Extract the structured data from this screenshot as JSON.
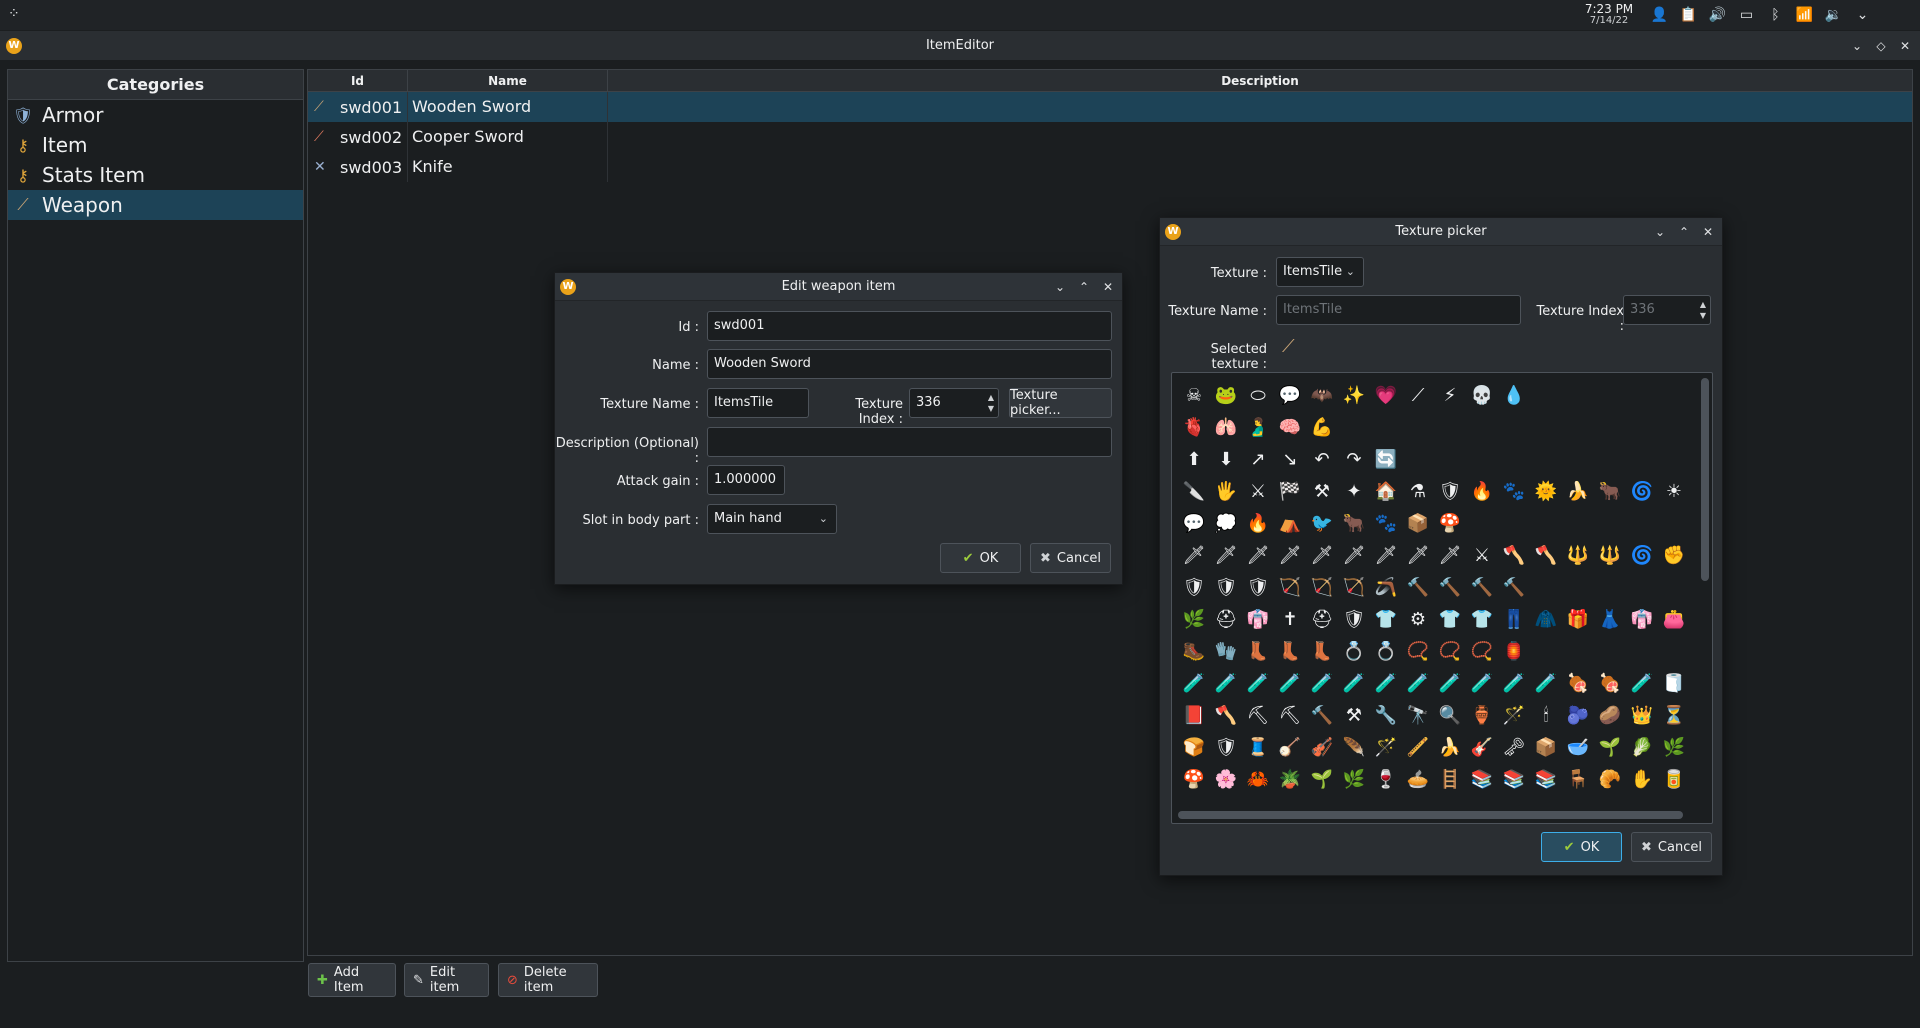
{
  "system_bar": {
    "launcher_icon": "launcher-icon",
    "time": "7:23 PM",
    "date": "7/14/22",
    "tray_icons": [
      "user-switch-icon",
      "clipboard-icon",
      "volume-icon",
      "battery-icon",
      "bluetooth-icon",
      "wifi-icon",
      "audio-icon",
      "chevron-down-icon"
    ]
  },
  "window": {
    "title": "ItemEditor",
    "app_icon_letter": "W",
    "controls": [
      "minimize-icon",
      "maximize-icon",
      "close-icon"
    ]
  },
  "categories": {
    "header": "Categories",
    "items": [
      {
        "label": "Armor",
        "icon": "shield-icon",
        "selected": false
      },
      {
        "label": "Item",
        "icon": "key-icon",
        "selected": false
      },
      {
        "label": "Stats Item",
        "icon": "key-icon",
        "selected": false
      },
      {
        "label": "Weapon",
        "icon": "sword-icon",
        "selected": true
      }
    ]
  },
  "table": {
    "columns": [
      "Id",
      "Name",
      "Description"
    ],
    "rows": [
      {
        "id": "swd001",
        "name": "Wooden Sword",
        "description": "",
        "selected": true
      },
      {
        "id": "swd002",
        "name": "Cooper Sword",
        "description": "",
        "selected": false
      },
      {
        "id": "swd003",
        "name": "Knife",
        "description": "",
        "selected": false
      }
    ]
  },
  "toolbar": {
    "add_label": "Add Item",
    "edit_label": "Edit item",
    "delete_label": "Delete item"
  },
  "edit_dialog": {
    "title": "Edit weapon item",
    "id_label": "Id :",
    "id_value": "swd001",
    "name_label": "Name :",
    "name_value": "Wooden Sword",
    "texture_name_label": "Texture Name :",
    "texture_name_value": "ItemsTile",
    "texture_index_label": "Texture Index :",
    "texture_index_value": "336",
    "texture_picker_label": "Texture picker...",
    "description_label": "Description (Optional) :",
    "description_value": "",
    "attack_gain_label": "Attack gain :",
    "attack_gain_value": "1.000000",
    "slot_label": "Slot in body part :",
    "slot_value": "Main hand",
    "ok_label": "OK",
    "cancel_label": "Cancel"
  },
  "texture_dialog": {
    "title": "Texture picker",
    "texture_label": "Texture :",
    "texture_value": "ItemsTile",
    "texture_name_label": "Texture Name :",
    "texture_name_placeholder": "ItemsTile",
    "texture_index_label": "Texture Index :",
    "texture_index_value": "336",
    "selected_texture_label": "Selected texture :",
    "ok_label": "OK",
    "cancel_label": "Cancel",
    "tiles": [
      "☠",
      "🐸",
      "⬭",
      "💬",
      "🦇",
      "✨",
      "💗",
      "⟋",
      "⚡",
      "💀",
      "💧",
      "",
      "",
      "",
      "",
      "",
      "🫀",
      "🫁",
      "🫃",
      "🧠",
      "💪",
      "",
      "",
      "",
      "",
      "",
      "",
      "",
      "",
      "",
      "",
      "",
      "⬆",
      "⬇",
      "↗",
      "↘",
      "↶",
      "↷",
      "🔄",
      "",
      "",
      "",
      "",
      "",
      "",
      "",
      "",
      "",
      "🔪",
      "🖐",
      "⚔",
      "🏁",
      "⚒",
      "✦",
      "🏠",
      "⚗",
      "🛡",
      "🔥",
      "🐾",
      "🌞",
      "🍌",
      "🐂",
      "🌀",
      "☀",
      "💬",
      "💭",
      "🔥",
      "⛺",
      "🐦",
      "🐂",
      "🐾",
      "📦",
      "🍄",
      "",
      "",
      "",
      "",
      "",
      "",
      "",
      "🗡",
      "🗡",
      "🗡",
      "🗡",
      "🗡",
      "🗡",
      "🗡",
      "🗡",
      "🗡",
      "⚔",
      "🪓",
      "🪓",
      "🔱",
      "🔱",
      "🌀",
      "✊",
      "🛡",
      "🛡",
      "🛡",
      "🏹",
      "🏹",
      "🏹",
      "🪃",
      "🔨",
      "🔨",
      "🔨",
      "🔨",
      "",
      "",
      "",
      "",
      "",
      "🌿",
      "⛑",
      "👘",
      "✝",
      "⛑",
      "🛡",
      "👕",
      "⚙",
      "👕",
      "👕",
      "👖",
      "🧥",
      "🎁",
      "👗",
      "👘",
      "👛",
      "🥾",
      "🧤",
      "👢",
      "👢",
      "👢",
      "💍",
      "💍",
      "📿",
      "📿",
      "📿",
      "🏮",
      "",
      "",
      "",
      "",
      "",
      "🧪",
      "🧪",
      "🧪",
      "🧪",
      "🧪",
      "🧪",
      "🧪",
      "🧪",
      "🧪",
      "🧪",
      "🧪",
      "🧪",
      "🍖",
      "🍖",
      "🧪",
      "🧻",
      "📕",
      "🪓",
      "⛏",
      "⛏",
      "🔨",
      "⚒",
      "🔧",
      "🔭",
      "🔍",
      "🏺",
      "🪄",
      "🕯",
      "🫐",
      "🥔",
      "👑",
      "⏳",
      "🍞",
      "🛡",
      "🧵",
      "🪕",
      "🎻",
      "🪶",
      "🪄",
      "🪈",
      "🍌",
      "🎸",
      "🗝",
      "📦",
      "🥣",
      "🌱",
      "🥬",
      "🌿",
      "🍄",
      "🌸",
      "🦀",
      "🪴",
      "🌱",
      "🌿",
      "🍷",
      "🥧",
      "🪜",
      "📚",
      "📚",
      "📚",
      "🪑",
      "🥐",
      "✋",
      "🥫"
    ]
  }
}
